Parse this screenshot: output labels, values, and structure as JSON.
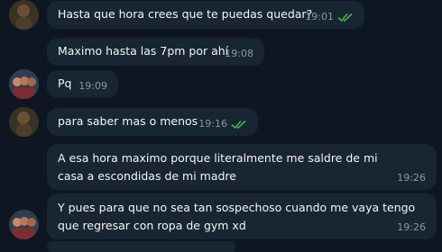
{
  "messages": [
    {
      "text": "Hasta que hora crees que te puedas quedar?",
      "time": "19:01",
      "read": true
    },
    {
      "text": "Maximo hasta las 7pm por ahí",
      "time": "19:08"
    },
    {
      "text": "Pq",
      "time": "19:09"
    },
    {
      "text": "para saber mas o menos",
      "time": "19:16",
      "read": true
    },
    {
      "text": "A esa hora maximo porque literalmente me saldre de mi casa a escondidas de mi madre",
      "time": "19:26"
    },
    {
      "text": "Y pues para que no sea tan sospechoso cuando me vaya tengo que regresar con ropa de gym xd",
      "time": "19:26"
    }
  ],
  "colors": {
    "background": "#0e1621",
    "bubble": "#182533",
    "text": "#f5f5f5",
    "time": "#8a97a6",
    "read_ticks": "#4fae4e"
  }
}
